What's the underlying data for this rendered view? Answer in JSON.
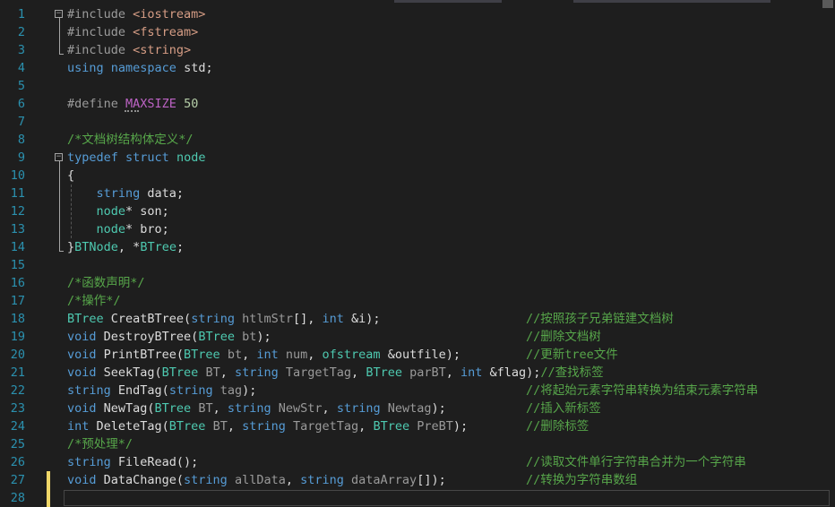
{
  "editor": {
    "lines": [
      {
        "num": "1",
        "tokens": [
          {
            "t": "#include ",
            "c": "pp"
          },
          {
            "t": "<iostream>",
            "c": "inc"
          }
        ]
      },
      {
        "num": "2",
        "tokens": [
          {
            "t": "#include ",
            "c": "pp"
          },
          {
            "t": "<fstream>",
            "c": "inc"
          }
        ]
      },
      {
        "num": "3",
        "tokens": [
          {
            "t": "#include ",
            "c": "pp"
          },
          {
            "t": "<string>",
            "c": "inc"
          }
        ]
      },
      {
        "num": "4",
        "tokens": [
          {
            "t": "using ",
            "c": "kw"
          },
          {
            "t": "namespace ",
            "c": "kw"
          },
          {
            "t": "std;",
            "c": "tx"
          }
        ]
      },
      {
        "num": "5",
        "tokens": []
      },
      {
        "num": "6",
        "tokens": [
          {
            "t": "#define ",
            "c": "pp"
          },
          {
            "t": "MAXSIZE",
            "c": "mac"
          },
          {
            "t": " 50",
            "c": "num"
          }
        ]
      },
      {
        "num": "7",
        "tokens": []
      },
      {
        "num": "8",
        "tokens": [
          {
            "t": "/*文档树结构体定义*/",
            "c": "cm"
          }
        ]
      },
      {
        "num": "9",
        "tokens": [
          {
            "t": "typedef ",
            "c": "kw"
          },
          {
            "t": "struct ",
            "c": "kw"
          },
          {
            "t": "node",
            "c": "ty"
          }
        ]
      },
      {
        "num": "10",
        "tokens": [
          {
            "t": "{",
            "c": "tx"
          }
        ]
      },
      {
        "num": "11",
        "tokens": [
          {
            "t": "    string ",
            "c": "kw"
          },
          {
            "t": "data;",
            "c": "tx"
          }
        ]
      },
      {
        "num": "12",
        "tokens": [
          {
            "t": "    node",
            "c": "ty"
          },
          {
            "t": "* son;",
            "c": "tx"
          }
        ]
      },
      {
        "num": "13",
        "tokens": [
          {
            "t": "    node",
            "c": "ty"
          },
          {
            "t": "* bro;",
            "c": "tx"
          }
        ]
      },
      {
        "num": "14",
        "tokens": [
          {
            "t": "}",
            "c": "tx"
          },
          {
            "t": "BTNode",
            "c": "ty"
          },
          {
            "t": ", *",
            "c": "tx"
          },
          {
            "t": "BTree",
            "c": "ty"
          },
          {
            "t": ";",
            "c": "tx"
          }
        ]
      },
      {
        "num": "15",
        "tokens": []
      },
      {
        "num": "16",
        "tokens": [
          {
            "t": "/*函数声明*/",
            "c": "cm"
          }
        ]
      },
      {
        "num": "17",
        "tokens": [
          {
            "t": "/*操作*/",
            "c": "cm"
          }
        ]
      },
      {
        "num": "18",
        "tokens": [
          {
            "t": "BTree ",
            "c": "ty"
          },
          {
            "t": "CreatBTree(",
            "c": "tx"
          },
          {
            "t": "string ",
            "c": "kw"
          },
          {
            "t": "htlmStr",
            "c": "pa"
          },
          {
            "t": "[], ",
            "c": "tx"
          },
          {
            "t": "int ",
            "c": "kw"
          },
          {
            "t": "&i);",
            "c": "tx"
          }
        ],
        "comment": "//按照孩子兄弟链建文档树"
      },
      {
        "num": "19",
        "tokens": [
          {
            "t": "void ",
            "c": "kw"
          },
          {
            "t": "DestroyBTree(",
            "c": "tx"
          },
          {
            "t": "BTree ",
            "c": "ty"
          },
          {
            "t": "bt",
            "c": "pa"
          },
          {
            "t": ");",
            "c": "tx"
          }
        ],
        "comment": "//删除文档树"
      },
      {
        "num": "20",
        "tokens": [
          {
            "t": "void ",
            "c": "kw"
          },
          {
            "t": "PrintBTree(",
            "c": "tx"
          },
          {
            "t": "BTree ",
            "c": "ty"
          },
          {
            "t": "bt",
            "c": "pa"
          },
          {
            "t": ", ",
            "c": "tx"
          },
          {
            "t": "int ",
            "c": "kw"
          },
          {
            "t": "num",
            "c": "pa"
          },
          {
            "t": ", ",
            "c": "tx"
          },
          {
            "t": "ofstream ",
            "c": "ty"
          },
          {
            "t": "&outfile);",
            "c": "tx"
          }
        ],
        "comment": "//更新tree文件"
      },
      {
        "num": "21",
        "tokens": [
          {
            "t": "void ",
            "c": "kw"
          },
          {
            "t": "SeekTag(",
            "c": "tx"
          },
          {
            "t": "BTree ",
            "c": "ty"
          },
          {
            "t": "BT",
            "c": "pa"
          },
          {
            "t": ", ",
            "c": "tx"
          },
          {
            "t": "string ",
            "c": "kw"
          },
          {
            "t": "TargetTag",
            "c": "pa"
          },
          {
            "t": ", ",
            "c": "tx"
          },
          {
            "t": "BTree ",
            "c": "ty"
          },
          {
            "t": "parBT",
            "c": "pa"
          },
          {
            "t": ", ",
            "c": "tx"
          },
          {
            "t": "int ",
            "c": "kw"
          },
          {
            "t": "&flag);",
            "c": "tx"
          },
          {
            "t": "//查找标签",
            "c": "cm"
          }
        ]
      },
      {
        "num": "22",
        "tokens": [
          {
            "t": "string ",
            "c": "kw"
          },
          {
            "t": "EndTag(",
            "c": "tx"
          },
          {
            "t": "string ",
            "c": "kw"
          },
          {
            "t": "tag",
            "c": "pa"
          },
          {
            "t": ");",
            "c": "tx"
          }
        ],
        "comment": "//将起始元素字符串转换为结束元素字符串"
      },
      {
        "num": "23",
        "tokens": [
          {
            "t": "void ",
            "c": "kw"
          },
          {
            "t": "NewTag(",
            "c": "tx"
          },
          {
            "t": "BTree ",
            "c": "ty"
          },
          {
            "t": "BT",
            "c": "pa"
          },
          {
            "t": ", ",
            "c": "tx"
          },
          {
            "t": "string ",
            "c": "kw"
          },
          {
            "t": "NewStr",
            "c": "pa"
          },
          {
            "t": ", ",
            "c": "tx"
          },
          {
            "t": "string ",
            "c": "kw"
          },
          {
            "t": "Newtag",
            "c": "pa"
          },
          {
            "t": ");",
            "c": "tx"
          }
        ],
        "comment": "//插入新标签"
      },
      {
        "num": "24",
        "tokens": [
          {
            "t": "int ",
            "c": "kw"
          },
          {
            "t": "DeleteTag(",
            "c": "tx"
          },
          {
            "t": "BTree ",
            "c": "ty"
          },
          {
            "t": "BT",
            "c": "pa"
          },
          {
            "t": ", ",
            "c": "tx"
          },
          {
            "t": "string ",
            "c": "kw"
          },
          {
            "t": "TargetTag",
            "c": "pa"
          },
          {
            "t": ", ",
            "c": "tx"
          },
          {
            "t": "BTree ",
            "c": "ty"
          },
          {
            "t": "PreBT",
            "c": "pa"
          },
          {
            "t": ");",
            "c": "tx"
          }
        ],
        "comment": "//删除标签"
      },
      {
        "num": "25",
        "tokens": [
          {
            "t": "/*预处理*/",
            "c": "cm"
          }
        ]
      },
      {
        "num": "26",
        "tokens": [
          {
            "t": "string ",
            "c": "kw"
          },
          {
            "t": "FileRead();",
            "c": "tx"
          }
        ],
        "comment": "//读取文件单行字符串合并为一个字符串"
      },
      {
        "num": "27",
        "tokens": [
          {
            "t": "void ",
            "c": "kw"
          },
          {
            "t": "DataChange(",
            "c": "tx"
          },
          {
            "t": "string ",
            "c": "kw"
          },
          {
            "t": "allData",
            "c": "pa"
          },
          {
            "t": ", ",
            "c": "tx"
          },
          {
            "t": "string ",
            "c": "kw"
          },
          {
            "t": "dataArray",
            "c": "pa"
          },
          {
            "t": "[]);",
            "c": "tx"
          }
        ],
        "comment": "//转换为字符串数组"
      },
      {
        "num": "28",
        "tokens": []
      }
    ],
    "colors": {
      "background": "#1e1e1e",
      "line_number": "#2b91af",
      "keyword": "#569cd6",
      "type": "#4ec9b0",
      "comment": "#57a64a",
      "include_path": "#d69d85",
      "macro": "#bd63c5",
      "change_marker": "#efd768"
    }
  }
}
